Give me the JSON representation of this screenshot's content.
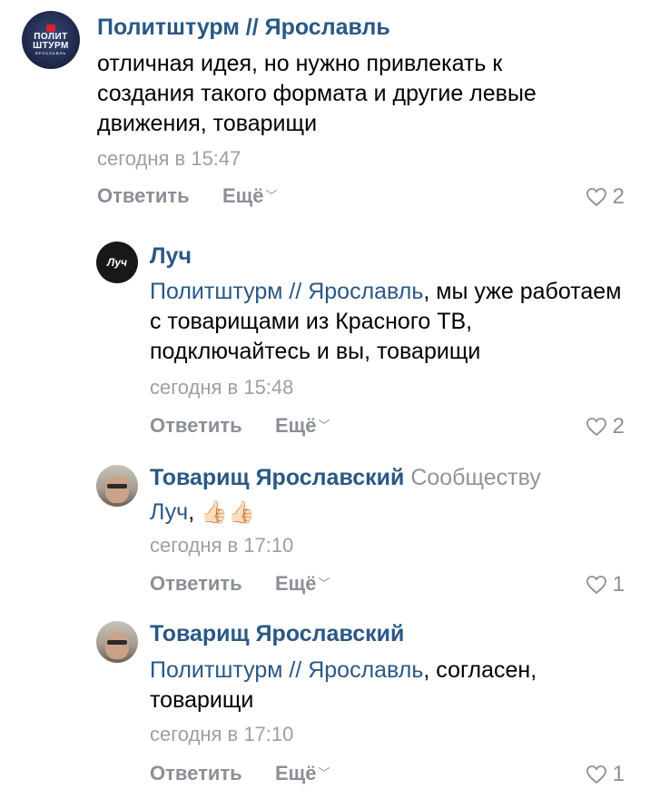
{
  "comments": [
    {
      "author": "Политштурм // Ярославль",
      "author_extra": "",
      "mention": "",
      "text": "отличная идея, но нужно привлекать к создания такого формата и другие левые движения, товарищи",
      "date": "сегодня в 15:47",
      "reply_label": "Ответить",
      "more_label": "Ещё",
      "likes": "2",
      "avatar_text": "ПОЛИТ ШТУРМ",
      "avatar_sub": "ЯРОСЛАВЛЬ"
    },
    {
      "author": "Луч",
      "author_extra": "",
      "mention": "Политштурм // Ярославль",
      "text": ", мы уже работаем с товарищами из Красного ТВ, подключайтесь и вы, товарищи",
      "date": "сегодня в 15:48",
      "reply_label": "Ответить",
      "more_label": "Ещё",
      "likes": "2",
      "avatar_text": "Луч"
    },
    {
      "author": "Товарищ Ярославский",
      "author_extra": "Сообществу",
      "mention": "Луч",
      "text": ", ",
      "emoji": "👍🏻👍🏻",
      "date": "сегодня в 17:10",
      "reply_label": "Ответить",
      "more_label": "Ещё",
      "likes": "1"
    },
    {
      "author": "Товарищ Ярославский",
      "author_extra": "",
      "mention": "Политштурм // Ярославль",
      "text": ", согласен, товарищи",
      "date": "сегодня в 17:10",
      "reply_label": "Ответить",
      "more_label": "Ещё",
      "likes": "1"
    }
  ],
  "icons": {
    "like": "heart-outline-icon",
    "more_chevron": "chevron-down-icon"
  },
  "colors": {
    "link": "#2a5885",
    "meta": "#8b9097",
    "date": "#9aa0a6"
  }
}
